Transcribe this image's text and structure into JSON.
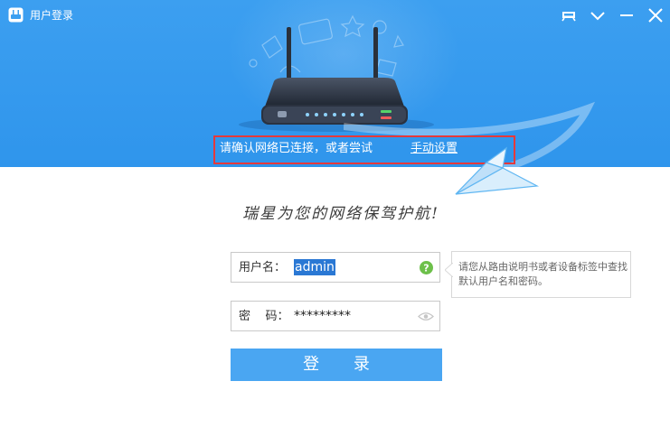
{
  "window": {
    "title": "用户登录",
    "icons": {
      "app": "router-app-icon",
      "skin": "skin-icon",
      "dropdown": "chevron-down-icon",
      "minimize": "minimize-icon",
      "close": "close-icon"
    }
  },
  "banner": {
    "notice_text": "请确认网络已连接，或者尝试",
    "manual_link": "手动设置",
    "accent_color": "#3c9ff0",
    "highlight_color": "#e5393b"
  },
  "slogan": "瑞星为您的网络保驾护航!",
  "form": {
    "username": {
      "label": "用户名：",
      "value": "admin",
      "icon": "help-icon"
    },
    "password": {
      "label": "密    码：",
      "value": "*********",
      "icon": "eye-icon"
    },
    "tooltip": "请您从路由说明书或者设备标签中查找默认用户名和密码。",
    "login_button": "登 录",
    "button_color": "#4aa6f2"
  }
}
